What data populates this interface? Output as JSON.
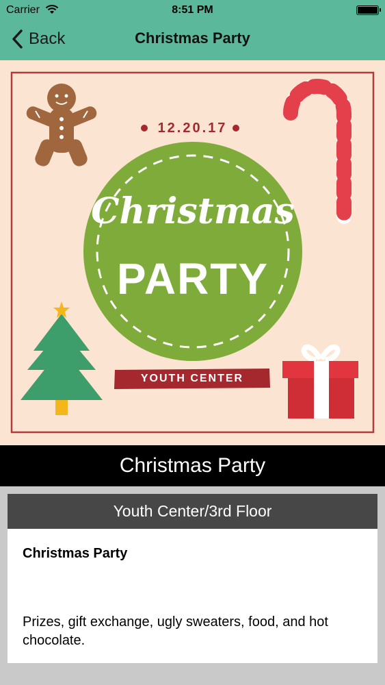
{
  "status_bar": {
    "carrier": "Carrier",
    "time": "8:51 PM"
  },
  "nav": {
    "back_label": "Back",
    "title": "Christmas Party"
  },
  "poster": {
    "date": "12.20.17",
    "script_text": "Christmas",
    "party_text": "PARTY",
    "venue_text": "YOUTH CENTER",
    "colors": {
      "background": "#fbe4d2",
      "circle": "#7eab3a",
      "banner": "#a4282e",
      "border": "#b33a3a"
    }
  },
  "event": {
    "caption": "Christmas Party",
    "location": "Youth Center/3rd Floor",
    "name": "Christmas Party",
    "description": "Prizes, gift exchange, ugly sweaters, food, and hot chocolate."
  },
  "colors": {
    "nav_bar": "#5bb89a",
    "caption_bg": "#000000",
    "card_header": "#474747"
  }
}
